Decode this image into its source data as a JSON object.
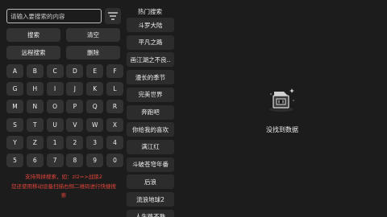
{
  "search": {
    "placeholder": "请输入要搜索的内容",
    "value": ""
  },
  "actions": {
    "search": "搜索",
    "clear": "清空",
    "remote_search": "远程搜索",
    "delete": "删除"
  },
  "keyboard_rows": [
    [
      "A",
      "B",
      "C",
      "D",
      "E",
      "F"
    ],
    [
      "G",
      "H",
      "I",
      "J",
      "K",
      "L"
    ],
    [
      "M",
      "N",
      "O",
      "P",
      "Q",
      "R"
    ],
    [
      "S",
      "T",
      "U",
      "V",
      "W",
      "X"
    ],
    [
      "Y",
      "Z",
      "1",
      "2",
      "3",
      "4"
    ],
    [
      "5",
      "6",
      "7",
      "8",
      "9",
      "0"
    ]
  ],
  "hints": {
    "line1": "支持简拼搜索，如：zl2=>战狼2",
    "line2": "您还使用移动设备扫描右侧二维码进行快捷搜",
    "line3": "索"
  },
  "hot": {
    "title": "热门搜索",
    "items": [
      "斗罗大陆",
      "平凡之路",
      "画江湖之不良..",
      "漫长的季节",
      "完美世界",
      "奔跑吧",
      "你给我的喜欢",
      "满江红",
      "斗破苍穹年番",
      "后浪",
      "流浪地球2",
      "人生路不熟"
    ]
  },
  "empty": {
    "text": "没找到数据",
    "icon": "empty-box-icon"
  },
  "colors": {
    "background": "#1c1c1c",
    "key": "#333333",
    "hint": "#e0443a"
  }
}
